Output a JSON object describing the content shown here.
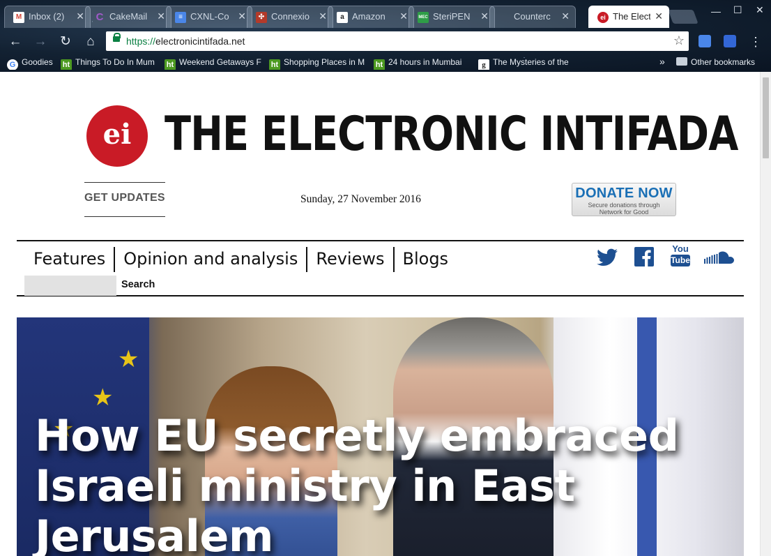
{
  "browser": {
    "tabs": [
      {
        "title": "Inbox (2)",
        "icon": "gmail-icon",
        "color": "#d44638",
        "glyph": "M"
      },
      {
        "title": "CakeMail",
        "icon": "cakemail-icon",
        "color": "#6a2a8a",
        "glyph": "C"
      },
      {
        "title": "CXNL-Co",
        "icon": "google-docs-icon",
        "color": "#4a86e8",
        "glyph": "≡"
      },
      {
        "title": "Connexio",
        "icon": "connexion-icon",
        "color": "#b33a2a",
        "glyph": "✣"
      },
      {
        "title": "Amazon",
        "icon": "amazon-icon",
        "color": "#ffffff",
        "glyph": "a"
      },
      {
        "title": "SteriPEN",
        "icon": "mec-icon",
        "color": "#2e9d47",
        "glyph": "MEC"
      },
      {
        "title": "Counterc",
        "icon": "counter-icon",
        "color": "#7f8a99",
        "glyph": ""
      },
      {
        "title": "The Electr",
        "icon": "ei-icon",
        "color": "#c91b26",
        "glyph": "ei"
      }
    ],
    "url_scheme": "https://",
    "url_host": "electronicintifada.net",
    "bookmarks": [
      {
        "label": "Goodies",
        "icon": "google-icon"
      },
      {
        "label": "Things To Do In Mum",
        "icon": "ht-icon"
      },
      {
        "label": "Weekend Getaways F",
        "icon": "ht-icon"
      },
      {
        "label": "Shopping Places in M",
        "icon": "ht-icon"
      },
      {
        "label": "24 hours in Mumbai",
        "icon": "ht-icon"
      },
      {
        "label": "The Mysteries of the",
        "icon": "g-icon"
      }
    ],
    "overflow_label": "»",
    "other_bookmarks": "Other bookmarks"
  },
  "site": {
    "logo_text": "ei",
    "title": "THE ELECTRONIC INTIFADA",
    "get_updates": "GET UPDATES",
    "date": "Sunday, 27 November 2016",
    "donate_title": "DONATE NOW",
    "donate_sub1": "Secure donations through",
    "donate_sub2": "Network for Good",
    "nav": [
      "Features",
      "Opinion and analysis",
      "Reviews",
      "Blogs"
    ],
    "search_label": "Search",
    "social": [
      "twitter-icon",
      "facebook-icon",
      "youtube-icon",
      "soundcloud-icon"
    ],
    "youtube_top": "You",
    "youtube_bottom": "Tube",
    "hero_headline": "How EU secretly embraced Israeli ministry in East Jerusalem"
  },
  "colors": {
    "brand_red": "#c91b26",
    "donate_blue": "#1a6fb5",
    "social_blue": "#1d4f91"
  }
}
